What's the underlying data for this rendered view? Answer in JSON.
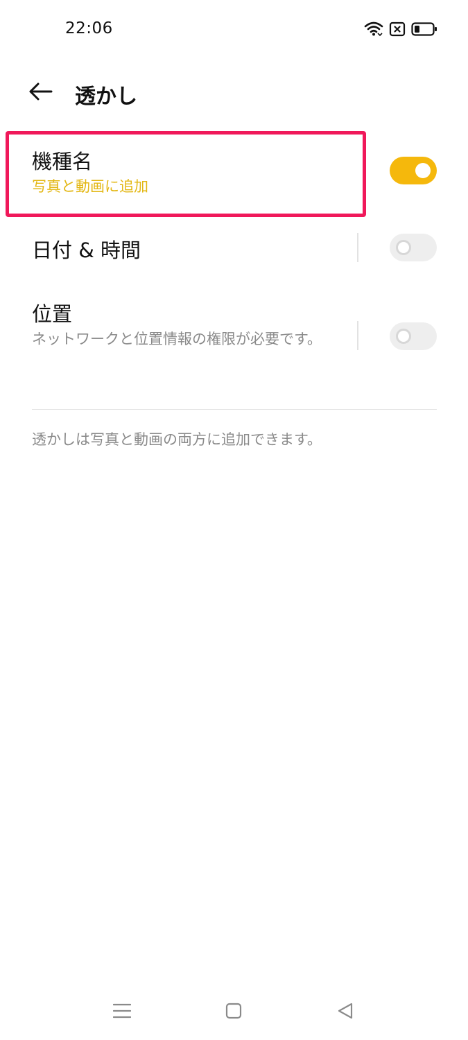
{
  "status_bar": {
    "time": "22:06",
    "icons": [
      "wifi-icon",
      "sim-blocked-icon",
      "battery-icon"
    ]
  },
  "header": {
    "back_icon": "arrow-left-icon",
    "title": "透かし"
  },
  "settings": [
    {
      "title": "機種名",
      "subtitle": "写真と動画に追加",
      "enabled": true
    },
    {
      "title": "日付 & 時間",
      "subtitle": "",
      "enabled": false
    },
    {
      "title": "位置",
      "subtitle": "ネットワークと位置情報の権限が必要です。",
      "enabled": false
    }
  ],
  "footnote": "透かしは写真と動画の両方に追加できます。",
  "nav_bar": {
    "icons": [
      "menu-icon",
      "home-icon",
      "back-triangle-icon"
    ]
  },
  "colors": {
    "accent": "#f5b80c",
    "subtitle_accent": "#e3b714",
    "highlight": "#f0185a",
    "muted_text": "#8a8a8a"
  }
}
